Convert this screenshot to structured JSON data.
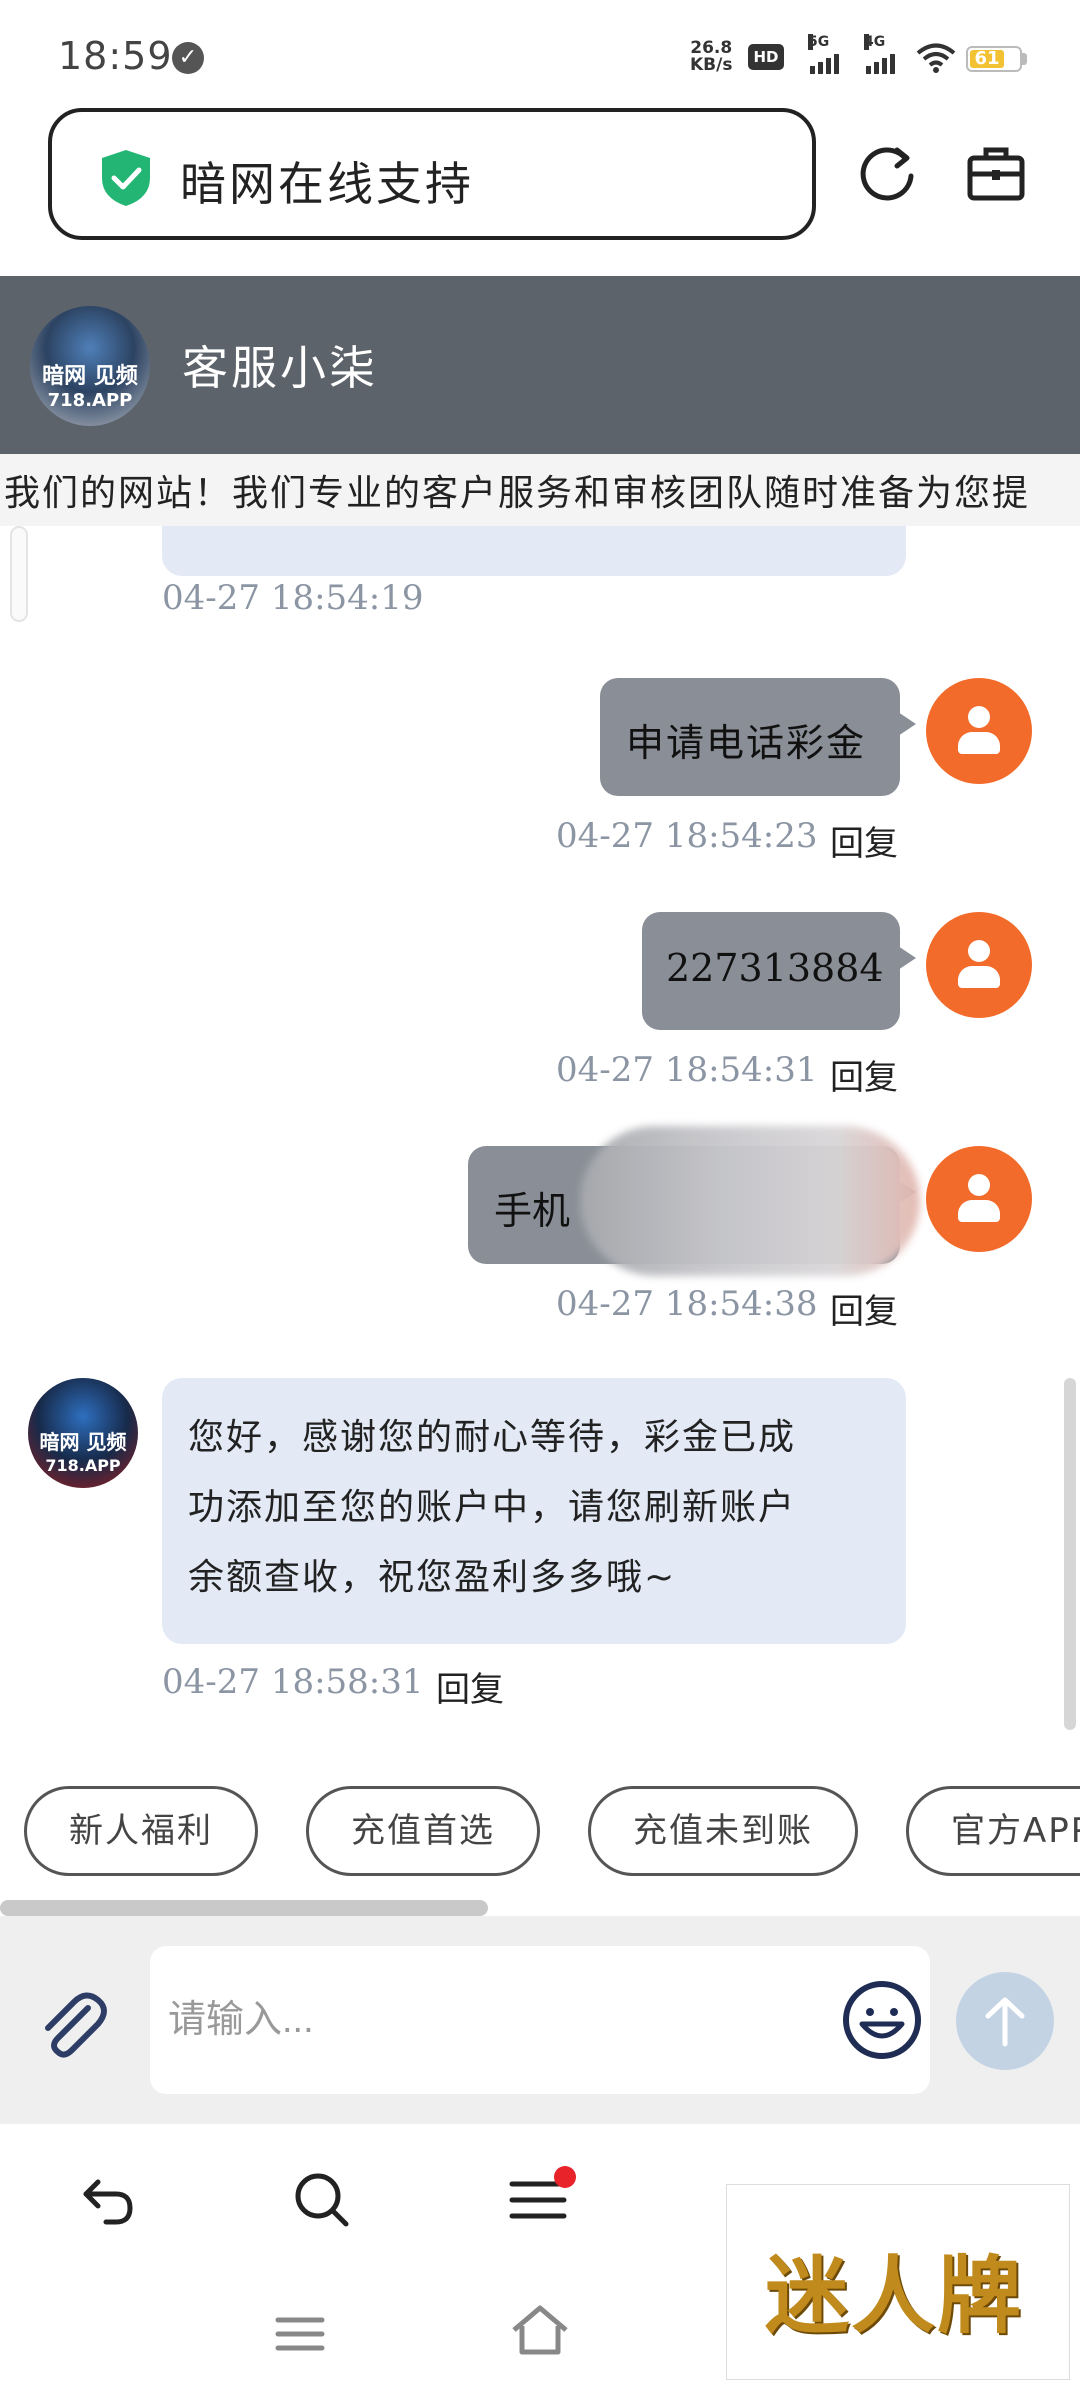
{
  "status_bar": {
    "time": "18:59",
    "net_speed_value": "26.8",
    "net_speed_unit": "KB/s",
    "hd_label": "HD",
    "sim1_label": "5G",
    "sim2_label": "4G",
    "battery": "61"
  },
  "browser": {
    "url_title": "暗网在线支持"
  },
  "chat_header": {
    "agent_name": "客服小柒",
    "avatar_text": "暗网 见频",
    "avatar_sub": "718.APP"
  },
  "marquee": {
    "text": "问我们的网站！我们专业的客户服务和审核团队随时准备为您提"
  },
  "messages": [
    {
      "time": "04-27 18:54:19"
    },
    {
      "text": "申请电话彩金",
      "time": "04-27 18:54:23",
      "reply": "回复"
    },
    {
      "text": "227313884",
      "time": "04-27 18:54:31",
      "reply": "回复"
    },
    {
      "text": "手机",
      "time": "04-27 18:54:38",
      "reply": "回复"
    },
    {
      "line1": "您好，感谢您的耐心等待，彩金已成",
      "line2": "功添加至您的账户中，请您刷新账户",
      "line3": "余额查收，祝您盈利多多哦~",
      "time": "04-27 18:58:31",
      "reply": "回复"
    }
  ],
  "quick_replies": [
    "新人福利",
    "充值首选",
    "充值未到账",
    "官方APP"
  ],
  "input": {
    "placeholder": "请输入..."
  },
  "watermark": "迷人牌",
  "colors": {
    "header_bg": "#5d636b",
    "user_avatar": "#f26b2a",
    "agent_bubble": "#e3eaf5",
    "user_bubble": "#8a8f97",
    "shield": "#22b573"
  }
}
